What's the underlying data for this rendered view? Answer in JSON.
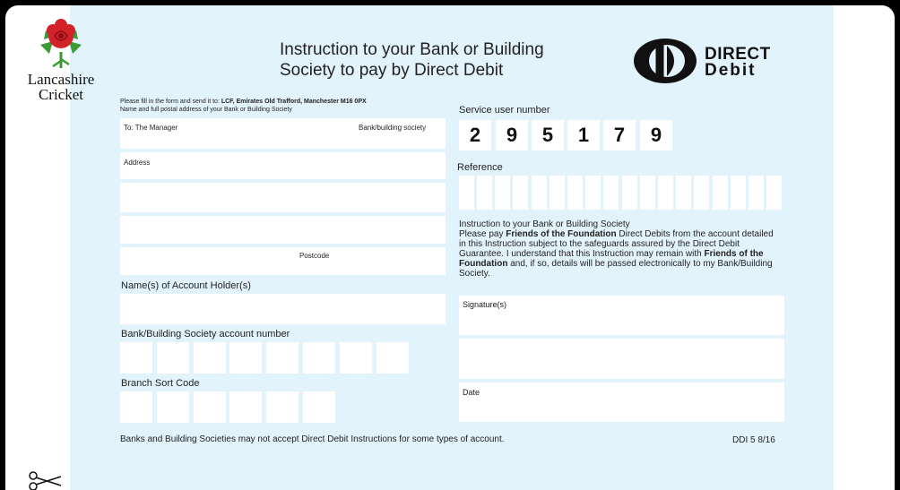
{
  "logo": {
    "line1": "Lancashire",
    "line2": "Cricket"
  },
  "title": {
    "line1": "Instruction to your Bank or Building",
    "line2": "Society to pay by Direct Debit"
  },
  "dd_logo": {
    "line1": "DIRECT",
    "line2": "Debit"
  },
  "left": {
    "send_prefix": "Please fill in the form and send it to: ",
    "send_address": "LCF, Emirates Old Trafford, Manchester M16 0PX",
    "name_address_label": "Name and full postal address of your Bank or Building Society",
    "to_manager": "To: The Manager",
    "bank_society": "Bank/building society",
    "address": "Address",
    "postcode": "Postcode",
    "account_holders": "Name(s) of Account Holder(s)",
    "account_number": "Bank/Building Society account number",
    "sort_code": "Branch Sort Code"
  },
  "right": {
    "service_user_label": "Service user number",
    "service_user_digits": [
      "2",
      "9",
      "5",
      "1",
      "7",
      "9"
    ],
    "reference_label": "Reference",
    "instr_heading": "Instruction to your Bank or Building Society",
    "instr_p1": "Please pay ",
    "instr_org1": "Friends of the Foundation",
    "instr_p2": " Direct Debits from the account detailed in this Instruction subject to the safeguards assured by the Direct Debit Guarantee. I understand that this Instruction may remain with ",
    "instr_org2": "Friends of the Foundation",
    "instr_p3": " and, if so, details will be passed electronically to my Bank/Building Society.",
    "signature": "Signature(s)",
    "date": "Date"
  },
  "footer": {
    "note": "Banks and Building Societies may not accept Direct Debit Instructions for some types of account.",
    "code": "DDI 5 8/16"
  },
  "colors": {
    "panel": "#e3f3fc",
    "rose_red": "#d2232a",
    "leaf_green": "#3c9a35"
  }
}
